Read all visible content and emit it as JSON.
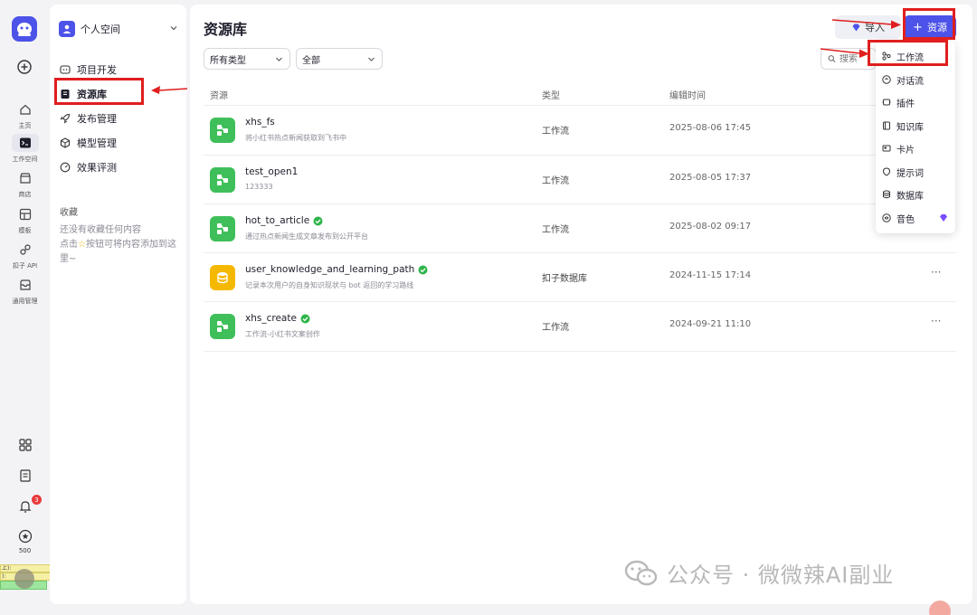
{
  "rail": {
    "items": [
      {
        "label": "主页"
      },
      {
        "label": "工作空间"
      },
      {
        "label": "商店"
      },
      {
        "label": "模板"
      },
      {
        "label": "扣子 API"
      },
      {
        "label": "通用管理"
      }
    ],
    "notification_count": "3",
    "points": "500"
  },
  "debug_panel": {
    "line1": "上):",
    "line2": "):"
  },
  "sidebar": {
    "space_name": "个人空间",
    "nav": [
      {
        "label": "项目开发"
      },
      {
        "label": "资源库"
      },
      {
        "label": "发布管理"
      },
      {
        "label": "模型管理"
      },
      {
        "label": "效果评测"
      }
    ],
    "favorites_title": "收藏",
    "favorites_empty_line1": "还没有收藏任何内容",
    "favorites_empty_line2": "点击",
    "favorites_empty_line3": "按钮可将内容添加到这里~"
  },
  "main": {
    "title": "资源库",
    "import_label": "导入",
    "add_label": "资源",
    "filters": {
      "type": "所有类型",
      "scope": "全部"
    },
    "search_placeholder": "搜索",
    "columns": {
      "resource": "资源",
      "type": "类型",
      "edit_time": "编辑时间"
    },
    "rows": [
      {
        "name": "xhs_fs",
        "desc": "将小红书热点新闻获取到飞书中",
        "type": "工作流",
        "time": "2025-08-06 17:45",
        "published": false,
        "kind": "workflow"
      },
      {
        "name": "test_open1",
        "desc": "123333",
        "type": "工作流",
        "time": "2025-08-05 17:37",
        "published": false,
        "kind": "workflow"
      },
      {
        "name": "hot_to_article",
        "desc": "通过热点新闻生成文章发布到公开平台",
        "type": "工作流",
        "time": "2025-08-02 09:17",
        "published": true,
        "kind": "workflow"
      },
      {
        "name": "user_knowledge_and_learning_path",
        "desc": "记录本次用户的自身知识现状与 bot 返回的学习路线",
        "type": "扣子数据库",
        "time": "2024-11-15 17:14",
        "published": true,
        "kind": "database"
      },
      {
        "name": "xhs_create",
        "desc": "工作流-小红书文案创作",
        "type": "工作流",
        "time": "2024-09-21 11:10",
        "published": true,
        "kind": "workflow"
      }
    ],
    "more_label": "···"
  },
  "menu": {
    "items": [
      {
        "label": "工作流",
        "icon": "workflow-icon"
      },
      {
        "label": "对话流",
        "icon": "chatflow-icon"
      },
      {
        "label": "插件",
        "icon": "plugin-icon"
      },
      {
        "label": "知识库",
        "icon": "knowledge-icon"
      },
      {
        "label": "卡片",
        "icon": "card-icon"
      },
      {
        "label": "提示词",
        "icon": "prompt-icon"
      },
      {
        "label": "数据库",
        "icon": "database-icon"
      },
      {
        "label": "音色",
        "icon": "voice-icon"
      }
    ]
  },
  "watermark": {
    "text": "公众号 · 微微辣AI副业"
  },
  "colors": {
    "accent": "#4d53e8",
    "workflow_green": "#3fbf5a",
    "database_yellow": "#f5b800",
    "annotation_red": "#e01e1e",
    "published_green": "#2fb54a"
  }
}
